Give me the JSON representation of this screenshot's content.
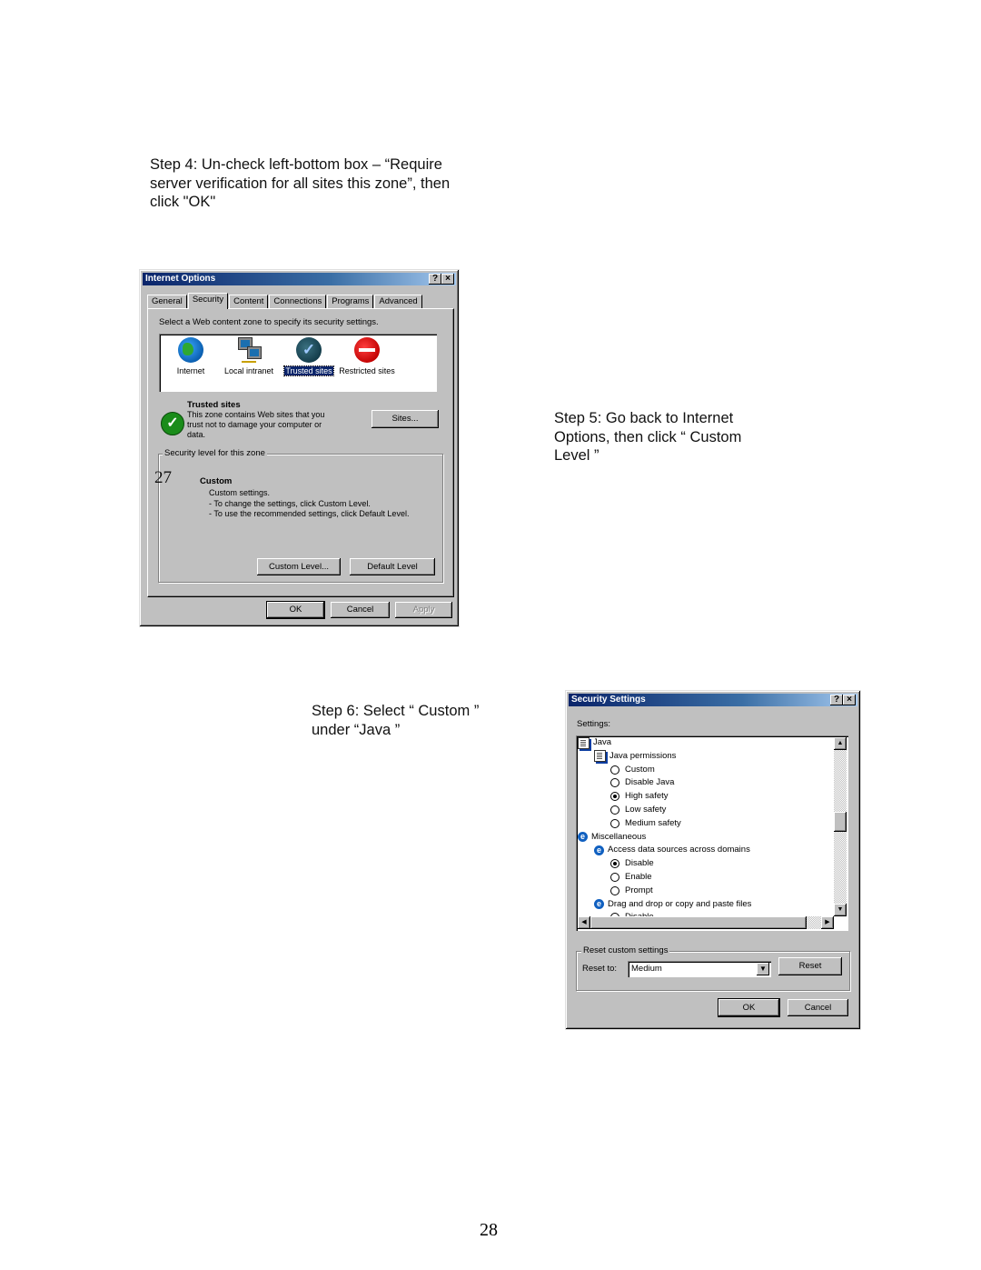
{
  "document": {
    "step4": "Step 4: Un-check left-bottom box – “Require server verification for all sites this zone”, then click \"OK\"",
    "step5": "Step 5: Go back to Internet Options, then click “ Custom Level ”",
    "step6": "Step 6: Select “ Custom ” under “Java ”",
    "page_number": "28",
    "overlay_number": "27"
  },
  "internet_options": {
    "title": "Internet Options",
    "help_btn": "?",
    "close_btn": "×",
    "tabs": [
      {
        "label": "General",
        "active": false
      },
      {
        "label": "Security",
        "active": true
      },
      {
        "label": "Content",
        "active": false
      },
      {
        "label": "Connections",
        "active": false
      },
      {
        "label": "Programs",
        "active": false
      },
      {
        "label": "Advanced",
        "active": false
      }
    ],
    "zone_prompt": "Select a Web content zone to specify its security settings.",
    "zones": [
      {
        "label": "Internet",
        "icon": "globe-icon",
        "selected": false
      },
      {
        "label": "Local intranet",
        "icon": "network-computers-icon",
        "selected": false
      },
      {
        "label": "Trusted sites",
        "icon": "checkmark-icon",
        "selected": true
      },
      {
        "label": "Restricted sites",
        "icon": "no-entry-icon",
        "selected": false
      }
    ],
    "zone_info": {
      "title": "Trusted sites",
      "description": "This zone contains Web sites that you trust not to damage your computer or data.",
      "check_glyph": "✓"
    },
    "sites_button": "Sites...",
    "security_level_legend": "Security level for this zone",
    "security_level": {
      "name": "Custom",
      "lines": [
        "Custom settings.",
        "- To change the settings, click Custom Level.",
        "- To use the recommended settings, click Default Level."
      ]
    },
    "custom_level_button": "Custom Level...",
    "default_level_button": "Default Level",
    "ok_button": "OK",
    "cancel_button": "Cancel",
    "apply_button": "Apply"
  },
  "security_settings": {
    "title": "Security Settings",
    "help_btn": "?",
    "close_btn": "×",
    "settings_label": "Settings:",
    "tree": [
      {
        "level": 0,
        "type": "doc",
        "label": "Java"
      },
      {
        "level": 1,
        "type": "doc",
        "label": "Java permissions"
      },
      {
        "level": 2,
        "type": "radio",
        "label": "Custom",
        "checked": false
      },
      {
        "level": 2,
        "type": "radio",
        "label": "Disable Java",
        "checked": false
      },
      {
        "level": 2,
        "type": "radio",
        "label": "High safety",
        "checked": true
      },
      {
        "level": 2,
        "type": "radio",
        "label": "Low safety",
        "checked": false
      },
      {
        "level": 2,
        "type": "radio",
        "label": "Medium safety",
        "checked": false
      },
      {
        "level": 0,
        "type": "ie",
        "label": "Miscellaneous"
      },
      {
        "level": 1,
        "type": "ie",
        "label": "Access data sources across domains"
      },
      {
        "level": 2,
        "type": "radio",
        "label": "Disable",
        "checked": true
      },
      {
        "level": 2,
        "type": "radio",
        "label": "Enable",
        "checked": false
      },
      {
        "level": 2,
        "type": "radio",
        "label": "Prompt",
        "checked": false
      },
      {
        "level": 1,
        "type": "ie",
        "label": "Drag and drop or copy and paste files"
      },
      {
        "level": 2,
        "type": "radio",
        "label": "Disable",
        "checked": false
      }
    ],
    "reset_legend": "Reset custom settings",
    "reset_to_label": "Reset to:",
    "reset_to_value": "Medium",
    "reset_button": "Reset",
    "ok_button": "OK",
    "cancel_button": "Cancel"
  }
}
